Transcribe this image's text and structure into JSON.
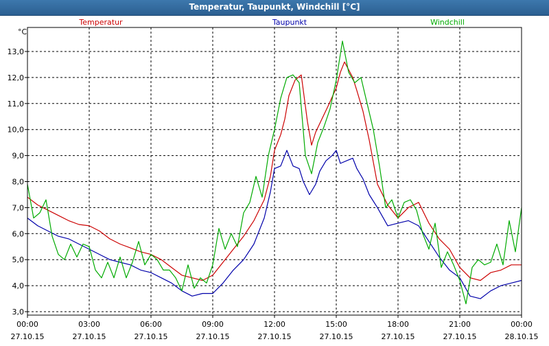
{
  "window": {
    "title": "Temperatur, Taupunkt, Windchill [°C]"
  },
  "chart_data": {
    "type": "line",
    "title": "Temperatur, Taupunkt, Windchill [°C]",
    "ylabel": "°C",
    "ylim": [
      3.0,
      13.5
    ],
    "yticks": [
      "3,0",
      "4,0",
      "5,0",
      "6,0",
      "7,0",
      "8,0",
      "9,0",
      "10,0",
      "11,0",
      "12,0",
      "13,0"
    ],
    "ytick_values": [
      3,
      4,
      5,
      6,
      7,
      8,
      9,
      10,
      11,
      12,
      13
    ],
    "xlim": [
      0,
      24
    ],
    "xticks": [
      {
        "time": "00:00",
        "date": "27.10.15",
        "h": 0
      },
      {
        "time": "03:00",
        "date": "27.10.15",
        "h": 3
      },
      {
        "time": "06:00",
        "date": "27.10.15",
        "h": 6
      },
      {
        "time": "09:00",
        "date": "27.10.15",
        "h": 9
      },
      {
        "time": "12:00",
        "date": "27.10.15",
        "h": 12
      },
      {
        "time": "15:00",
        "date": "27.10.15",
        "h": 15
      },
      {
        "time": "18:00",
        "date": "27.10.15",
        "h": 18
      },
      {
        "time": "21:00",
        "date": "27.10.15",
        "h": 21
      },
      {
        "time": "00:00",
        "date": "28.10.15",
        "h": 24
      }
    ],
    "grid": true,
    "series": [
      {
        "name": "Temperatur",
        "color": "#cc0000",
        "x": [
          0,
          0.5,
          1,
          1.5,
          2,
          2.5,
          3,
          3.5,
          4,
          4.5,
          5,
          5.5,
          6,
          6.5,
          7,
          7.5,
          8,
          8.5,
          9,
          9.5,
          10,
          10.5,
          11,
          11.5,
          11.8,
          12,
          12.3,
          12.5,
          12.7,
          13,
          13.3,
          13.6,
          13.8,
          14,
          14.3,
          14.6,
          15,
          15.2,
          15.4,
          15.6,
          15.8,
          16,
          16.3,
          16.6,
          17,
          17.5,
          18,
          18.5,
          19,
          19.5,
          20,
          20.5,
          21,
          21.5,
          22,
          22.5,
          23,
          23.5,
          24
        ],
        "values": [
          7.4,
          7.1,
          6.9,
          6.7,
          6.5,
          6.35,
          6.3,
          6.1,
          5.8,
          5.6,
          5.45,
          5.3,
          5.2,
          5.0,
          4.7,
          4.4,
          4.3,
          4.2,
          4.4,
          4.9,
          5.4,
          5.9,
          6.5,
          7.3,
          8.2,
          9.2,
          9.8,
          10.4,
          11.3,
          11.9,
          12.1,
          10.3,
          9.4,
          9.9,
          10.4,
          10.9,
          11.6,
          12.2,
          12.6,
          12.3,
          12.0,
          11.5,
          10.7,
          9.6,
          7.9,
          7.1,
          6.6,
          7.0,
          7.2,
          6.4,
          5.8,
          5.4,
          4.7,
          4.3,
          4.2,
          4.5,
          4.6,
          4.8,
          4.8
        ]
      },
      {
        "name": "Taupunkt",
        "color": "#0000aa",
        "x": [
          0,
          0.5,
          1,
          1.5,
          2,
          2.5,
          3,
          3.5,
          4,
          4.5,
          5,
          5.5,
          6,
          6.5,
          7,
          7.5,
          8,
          8.5,
          9,
          9.5,
          10,
          10.5,
          11,
          11.5,
          11.8,
          12,
          12.3,
          12.6,
          12.9,
          13.2,
          13.4,
          13.7,
          14,
          14.2,
          14.5,
          14.8,
          15,
          15.2,
          15.5,
          15.8,
          16,
          16.3,
          16.6,
          17,
          17.5,
          18,
          18.5,
          19,
          19.5,
          20,
          20.5,
          21,
          21.5,
          22,
          22.5,
          23,
          23.5,
          24
        ],
        "values": [
          6.6,
          6.3,
          6.1,
          5.9,
          5.8,
          5.6,
          5.4,
          5.2,
          5.0,
          4.9,
          4.8,
          4.6,
          4.5,
          4.3,
          4.1,
          3.8,
          3.6,
          3.7,
          3.7,
          4.1,
          4.6,
          5.0,
          5.6,
          6.6,
          7.6,
          8.5,
          8.6,
          9.2,
          8.6,
          8.5,
          8.0,
          7.5,
          7.9,
          8.4,
          8.8,
          9.0,
          9.2,
          8.7,
          8.8,
          8.9,
          8.5,
          8.1,
          7.5,
          7.0,
          6.3,
          6.4,
          6.5,
          6.3,
          5.7,
          5.1,
          4.6,
          4.3,
          3.6,
          3.5,
          3.8,
          4.0,
          4.1,
          4.2
        ]
      },
      {
        "name": "Windchill",
        "color": "#00aa00",
        "x": [
          0,
          0.3,
          0.6,
          0.9,
          1.2,
          1.5,
          1.8,
          2.1,
          2.4,
          2.7,
          3,
          3.3,
          3.6,
          3.9,
          4.2,
          4.5,
          4.8,
          5.1,
          5.4,
          5.7,
          6,
          6.3,
          6.6,
          6.9,
          7.2,
          7.5,
          7.8,
          8.1,
          8.4,
          8.7,
          9,
          9.3,
          9.6,
          9.9,
          10.2,
          10.5,
          10.8,
          11.1,
          11.4,
          11.7,
          12,
          12.3,
          12.6,
          12.9,
          13.2,
          13.5,
          13.8,
          14.1,
          14.4,
          14.7,
          15,
          15.3,
          15.6,
          15.9,
          16.2,
          16.5,
          16.8,
          17.1,
          17.4,
          17.7,
          18,
          18.3,
          18.6,
          18.9,
          19.2,
          19.5,
          19.8,
          20.1,
          20.4,
          20.7,
          21,
          21.3,
          21.6,
          21.9,
          22.2,
          22.5,
          22.8,
          23.1,
          23.4,
          23.7,
          24
        ],
        "values": [
          7.9,
          6.6,
          6.8,
          7.3,
          5.9,
          5.2,
          5.0,
          5.6,
          5.1,
          5.6,
          5.5,
          4.6,
          4.3,
          4.9,
          4.3,
          5.1,
          4.3,
          4.9,
          5.7,
          4.8,
          5.2,
          5.0,
          4.6,
          4.6,
          4.3,
          3.8,
          4.8,
          3.9,
          4.3,
          4.1,
          4.8,
          6.2,
          5.4,
          6.0,
          5.5,
          6.8,
          7.2,
          8.2,
          7.4,
          9.0,
          10.0,
          11.2,
          12.0,
          12.1,
          11.8,
          9.0,
          8.3,
          9.5,
          10.1,
          10.8,
          11.9,
          13.4,
          12.2,
          11.8,
          12.0,
          11.0,
          10.0,
          8.6,
          7.0,
          7.3,
          6.6,
          7.2,
          7.3,
          6.9,
          6.0,
          5.4,
          6.4,
          4.7,
          5.3,
          4.8,
          4.2,
          3.3,
          4.7,
          5.0,
          4.8,
          4.9,
          5.6,
          4.8,
          6.5,
          5.3,
          7.0
        ]
      }
    ]
  }
}
